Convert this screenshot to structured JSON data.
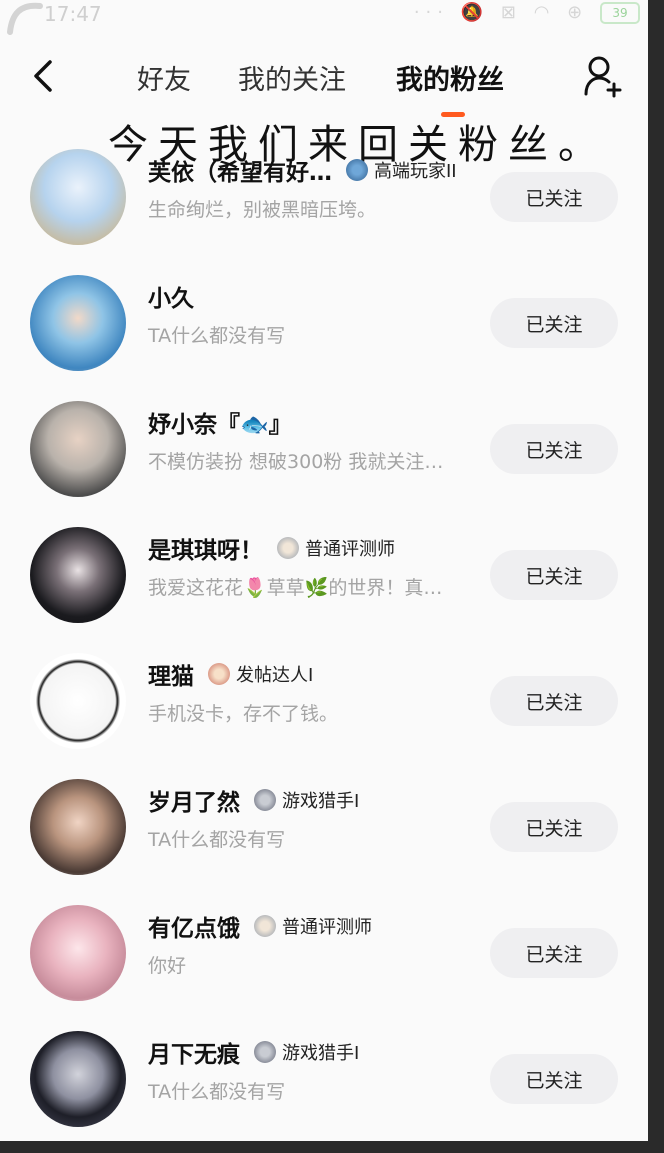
{
  "status_bar": {
    "time": "17:47",
    "battery": "39"
  },
  "header": {
    "tabs": [
      {
        "label": "好友"
      },
      {
        "label": "我的关注"
      },
      {
        "label": "我的粉丝"
      }
    ],
    "overlay_text": "今天我们来回关粉丝。"
  },
  "fans": [
    {
      "name": "芙依（希望有好…",
      "badge": "高端玩家II",
      "bio": "生命绚烂，别被黑暗压垮。",
      "button": "已关注"
    },
    {
      "name": "小久",
      "badge": "",
      "bio": "TA什么都没有写",
      "button": "已关注"
    },
    {
      "name": "妤小奈『🐟』",
      "badge": "",
      "bio": "不模仿装扮 想破300粉 我就关注…",
      "button": "已关注"
    },
    {
      "name": "是琪琪呀！",
      "badge": "普通评测师",
      "bio": "我爱这花花🌷草草🌿的世界！真…",
      "button": "已关注"
    },
    {
      "name": "理猫",
      "badge": "发帖达人I",
      "bio": "手机没卡，存不了钱。",
      "button": "已关注"
    },
    {
      "name": "岁月了然",
      "badge": "游戏猎手I",
      "bio": "TA什么都没有写",
      "button": "已关注"
    },
    {
      "name": "有亿点饿",
      "badge": "普通评测师",
      "bio": "你好",
      "button": "已关注"
    },
    {
      "name": "月下无痕",
      "badge": "游戏猎手I",
      "bio": "TA什么都没有写",
      "button": "已关注"
    }
  ],
  "colors": {
    "accent": "#ff5a1f",
    "button_bg": "#efeff1",
    "bio_text": "#a4a4a4"
  },
  "icons": [
    "back-arrow-icon",
    "add-user-icon"
  ]
}
